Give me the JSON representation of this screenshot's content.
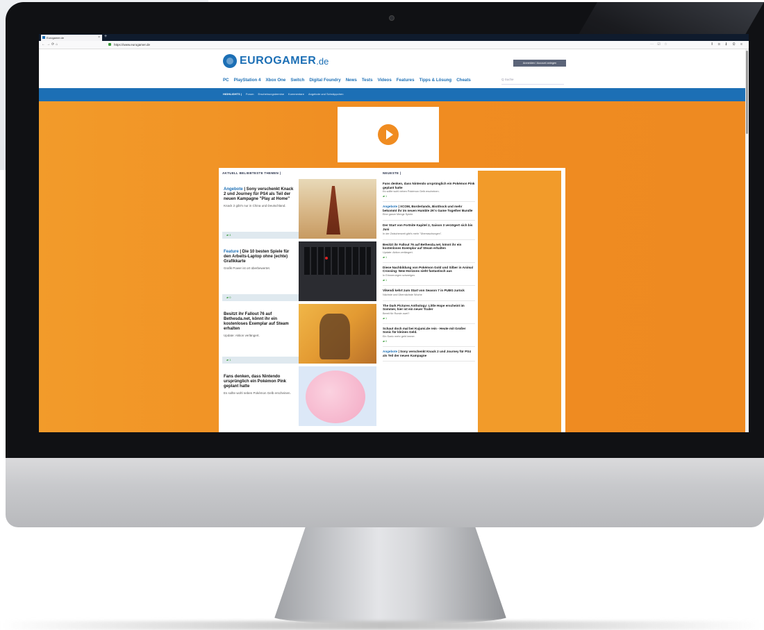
{
  "browser": {
    "tab_title": "Eurogamer.de",
    "tab_close": "×",
    "new_tab": "+",
    "nav_buttons": "←→⟳⌂",
    "url": "https://www.eurogamer.de",
    "right_icons": "⋯ ☑ ☆",
    "extension_icons": "⫴ ⊡ ⬇ ⚙ ≡"
  },
  "site": {
    "brand": "EUROGAMER",
    "tld": ".de",
    "account_button": "Anmelden / Account anlegen",
    "nav": [
      "PC",
      "PlayStation 4",
      "Xbox One",
      "Switch",
      "Digital Foundry",
      "News",
      "Tests",
      "Videos",
      "Features",
      "Tipps & Lösung",
      "Cheats"
    ],
    "search_placeholder": "Q Suche",
    "subnav": [
      "HIGHLIGHTS |",
      "Forum",
      "Erscheinungstermine",
      "Kommentare",
      "Angebote und Schnäppchen"
    ]
  },
  "popular": {
    "title": "AKTUELL BELIEBTESTE THEMEN |",
    "items": [
      {
        "tag": "Angebote",
        "headline": " | Sony verschenkt Knack 2 und Journey für PS4 als Teil der neuen Kampagne \"Play at Home\"",
        "desc": "Knack 2 gibt's nur in China und Deutschland.",
        "comments": "▰ 4"
      },
      {
        "tag": "Feature",
        "headline": " | Die 10 besten Spiele für den Arbeits-Laptop ohne (echte) Grafikkarte",
        "desc": "Grafik Power ist ort überbewertet.",
        "comments": "▰ 0"
      },
      {
        "tag": "",
        "headline": "Besitzt ihr Fallout 76 auf Bethesda.net, könnt ihr ein kostenloses Exemplar auf Steam erhalten",
        "desc": "Update: Aktion verlängert.",
        "comments": "▰ 1"
      },
      {
        "tag": "",
        "headline": "Fans denken, dass Nintendo ursprünglich ein Pokémon Pink geplant hatte",
        "desc": "Es sollte wohl neben Pokémon Gelb erscheinen.",
        "comments": ""
      }
    ]
  },
  "latest": {
    "title": "NEUESTE |",
    "items": [
      {
        "tag": "",
        "headline": "Fans denken, dass Nintendo ursprünglich ein Pokémon Pink geplant hatte",
        "sub": "Es sollte wohl neben Pokémon Gelb erscheinen.",
        "comments": "▰ 1"
      },
      {
        "tag": "Angebote",
        "headline": " | XCOM, Borderlands, BioShock und mehr bekommt ihr im neuen Humble 2K's Game Together Bundle",
        "sub": "Eine ganze Menge Spiele.",
        "comments": ""
      },
      {
        "tag": "",
        "headline": "Der Start von Fortnite Kapitel 2, Saison 3 verzögert sich bis Juni",
        "sub": "In der Zwischenzeit gibt's mehr \"Überraschungen\".",
        "comments": ""
      },
      {
        "tag": "",
        "headline": "Besitzt ihr Fallout 76 auf Bethesda.net, könnt ihr ein kostenloses Exemplar auf Steam erhalten",
        "sub": "Update: Aktion verlängert.",
        "comments": "▰ 1"
      },
      {
        "tag": "",
        "headline": "Diese Nachbildung von Pokémon Gold und Silber in Animal Crossing: New Horizons sieht fantastisch aus",
        "sub": "In Erinnerungen schwelgen.",
        "comments": "▰ 1"
      },
      {
        "tag": "",
        "headline": "Vikendi kehrt zum Start von Season 7 in PUBG zurück",
        "sub": "Nächste und Übernächste Woche",
        "comments": ""
      },
      {
        "tag": "",
        "headline": "The Dark Pictures Anthology: Little Hope erscheint im Sommer, hier ist ein neuer Trailer",
        "sub": "Bereit für Runde zwei?",
        "comments": "▰ 1"
      },
      {
        "tag": "",
        "headline": "Schaut doch mal bei Kujumi.de rein - Heute mit Großer Sonic für kleines Geld.",
        "sub": "Ein Sonic mehr geht immer.",
        "comments": "▰ 0"
      },
      {
        "tag": "Angebote",
        "headline": " | Sony verschenkt Knack 2 und Journey für PS4 als Teil der neuen Kampagne",
        "sub": "",
        "comments": ""
      }
    ]
  },
  "colors": {
    "brand_blue": "#1c6fb5",
    "orange": "#f08c21"
  }
}
